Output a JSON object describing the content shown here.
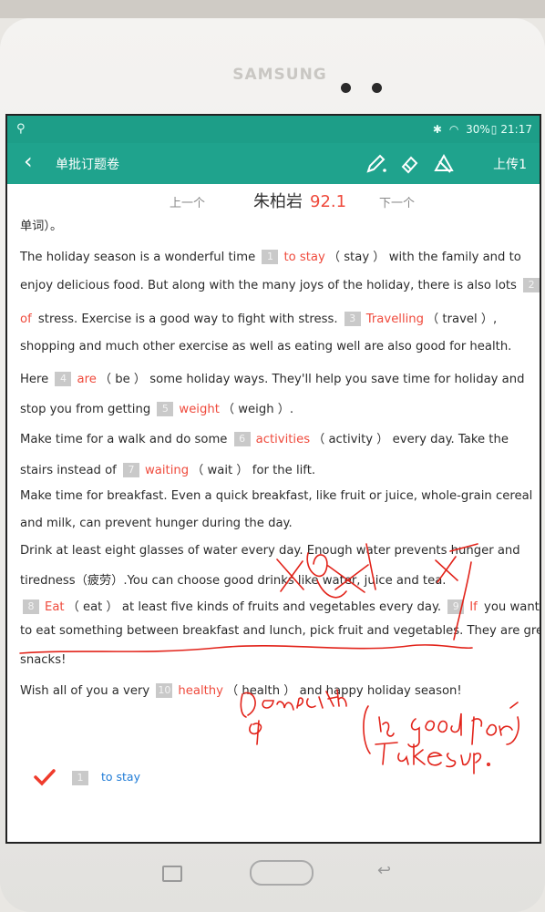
{
  "device": {
    "brand": "SAMSUNG"
  },
  "status": {
    "battery": "30%",
    "time": "21:17"
  },
  "appbar": {
    "back_icon": "chevron-left-icon",
    "title": "单批订题卷",
    "upload_label": "上传1",
    "tools": [
      "pencil-icon",
      "eraser-icon",
      "clear-icon"
    ],
    "accent": "#1fa38d"
  },
  "nav": {
    "prev_label": "上一个",
    "next_label": "下一个",
    "student_name": "朱柏岩",
    "score": "92.1"
  },
  "passage": {
    "intro": "单词）。",
    "l1a": "The holiday season is a wonderful time",
    "n1": "1",
    "a1": "to stay",
    "h1": "（ stay ）",
    "l1b": "with the family and to",
    "l2a": "enjoy delicious food. But along with the many joys of the holiday, there is also lots",
    "n2": "2",
    "a2": "of",
    "l3a": "stress. Exercise is a good way to fight with stress.",
    "n3": "3",
    "a3": "Travelling",
    "h3": "（ travel ）,",
    "l4": "shopping and much other exercise as well as eating well are also good for health.",
    "l5a": "Here",
    "n4": "4",
    "a4": "are",
    "h4": "（ be ）",
    "l5b": "some holiday ways. They'll help you save time for holiday and",
    "l6a": "stop you from getting",
    "n5": "5",
    "a5": "weight",
    "h5": "（ weigh ）.",
    "l7a": "Make time for a walk and do some",
    "n6": "6",
    "a6": "activities",
    "h6": "（ activity ）",
    "l7b": "every day. Take the",
    "l8a": "stairs instead of",
    "n7": "7",
    "a7": "waiting",
    "h7": "（ wait ）",
    "l8b": "for the lift.",
    "l9": "Make time for breakfast. Even a quick breakfast, like fruit or juice, whole-grain cereal",
    "l10": "and milk, can prevent hunger during the day.",
    "l11": "Drink at least eight glasses of water every day. Enough water prevents hunger and",
    "l12": "tiredness（疲劳）.You can choose good drinks like water, juice and tea.",
    "n8": "8",
    "a8": "Eat",
    "h8": "（ eat ）",
    "l13b": "at least five kinds of fruits and vegetables every day.",
    "n9": "9",
    "a9": "If",
    "l13c": "you want",
    "l14": "to eat something between breakfast and lunch, pick fruit and vegetables. They are great",
    "l15": "snacks!",
    "l16a": "Wish all of you a very",
    "n10": "10",
    "a10": "healthy",
    "h10": "（ health ）",
    "l16b": "and happy holiday season!"
  },
  "results": [
    {
      "mark": "check-icon",
      "num": "1",
      "answer": "to stay"
    }
  ],
  "colors": {
    "wrong_answer_red": "#ef4a3c",
    "result_blue": "#1f7bd6"
  }
}
